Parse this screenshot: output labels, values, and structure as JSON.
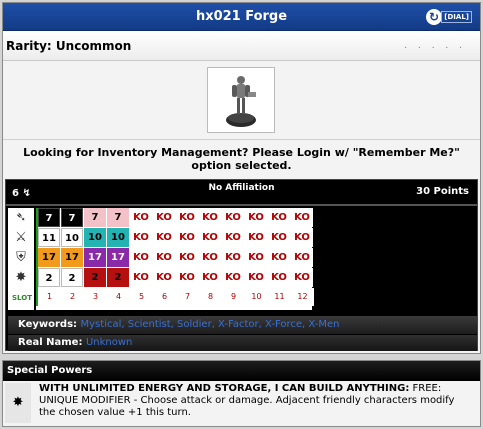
{
  "header": {
    "title": "hx021 Forge",
    "dial_label": "[DIAL]",
    "back_icon": "refresh-icon"
  },
  "rarity": {
    "text": "Rarity: Uncommon",
    "dots": ". . . . ."
  },
  "inventory_message": "Looking for Inventory Management? Please Login w/ \"Remember Me?\" option selected.",
  "dial": {
    "left_points": "6",
    "affiliation": "No Affiliation",
    "points": "30 Points",
    "stat_icons": [
      "speed-icon",
      "attack-icon",
      "defense-icon",
      "damage-icon"
    ],
    "slot_label": "SLOT",
    "rows": [
      [
        {
          "v": "7",
          "c": "black"
        },
        {
          "v": "7",
          "c": "black"
        },
        {
          "v": "7",
          "c": "pink"
        },
        {
          "v": "7",
          "c": "pink"
        },
        {
          "v": "KO",
          "c": "ko"
        },
        {
          "v": "KO",
          "c": "ko"
        },
        {
          "v": "KO",
          "c": "ko"
        },
        {
          "v": "KO",
          "c": "ko"
        },
        {
          "v": "KO",
          "c": "ko"
        },
        {
          "v": "KO",
          "c": "ko"
        },
        {
          "v": "KO",
          "c": "ko"
        },
        {
          "v": "KO",
          "c": "ko"
        }
      ],
      [
        {
          "v": "11",
          "c": "white"
        },
        {
          "v": "10",
          "c": "white"
        },
        {
          "v": "10",
          "c": "teal"
        },
        {
          "v": "10",
          "c": "teal"
        },
        {
          "v": "KO",
          "c": "ko"
        },
        {
          "v": "KO",
          "c": "ko"
        },
        {
          "v": "KO",
          "c": "ko"
        },
        {
          "v": "KO",
          "c": "ko"
        },
        {
          "v": "KO",
          "c": "ko"
        },
        {
          "v": "KO",
          "c": "ko"
        },
        {
          "v": "KO",
          "c": "ko"
        },
        {
          "v": "KO",
          "c": "ko"
        }
      ],
      [
        {
          "v": "17",
          "c": "orange"
        },
        {
          "v": "17",
          "c": "orange"
        },
        {
          "v": "17",
          "c": "purple"
        },
        {
          "v": "17",
          "c": "purple"
        },
        {
          "v": "KO",
          "c": "ko"
        },
        {
          "v": "KO",
          "c": "ko"
        },
        {
          "v": "KO",
          "c": "ko"
        },
        {
          "v": "KO",
          "c": "ko"
        },
        {
          "v": "KO",
          "c": "ko"
        },
        {
          "v": "KO",
          "c": "ko"
        },
        {
          "v": "KO",
          "c": "ko"
        },
        {
          "v": "KO",
          "c": "ko"
        }
      ],
      [
        {
          "v": "2",
          "c": "white"
        },
        {
          "v": "2",
          "c": "white"
        },
        {
          "v": "2",
          "c": "red"
        },
        {
          "v": "2",
          "c": "red"
        },
        {
          "v": "KO",
          "c": "ko"
        },
        {
          "v": "KO",
          "c": "ko"
        },
        {
          "v": "KO",
          "c": "ko"
        },
        {
          "v": "KO",
          "c": "ko"
        },
        {
          "v": "KO",
          "c": "ko"
        },
        {
          "v": "KO",
          "c": "ko"
        },
        {
          "v": "KO",
          "c": "ko"
        },
        {
          "v": "KO",
          "c": "ko"
        }
      ]
    ],
    "slots": [
      "1",
      "2",
      "3",
      "4",
      "5",
      "6",
      "7",
      "8",
      "9",
      "10",
      "11",
      "12"
    ]
  },
  "keywords": {
    "label": "Keywords:",
    "items": [
      "Mystical",
      "Scientist",
      "Soldier",
      "X-Factor",
      "X-Force",
      "X-Men"
    ]
  },
  "real_name": {
    "label": "Real Name:",
    "value": "Unknown"
  },
  "special_powers": {
    "title": "Special Powers",
    "icon": "wrench-burst-icon",
    "power_name": "WITH UNLIMITED ENERGY AND STORAGE, I CAN BUILD ANYTHING:",
    "power_text": "FREE: UNIQUE MODIFIER - Choose attack or damage. Adjacent friendly characters modify the chosen value +1 this turn."
  }
}
